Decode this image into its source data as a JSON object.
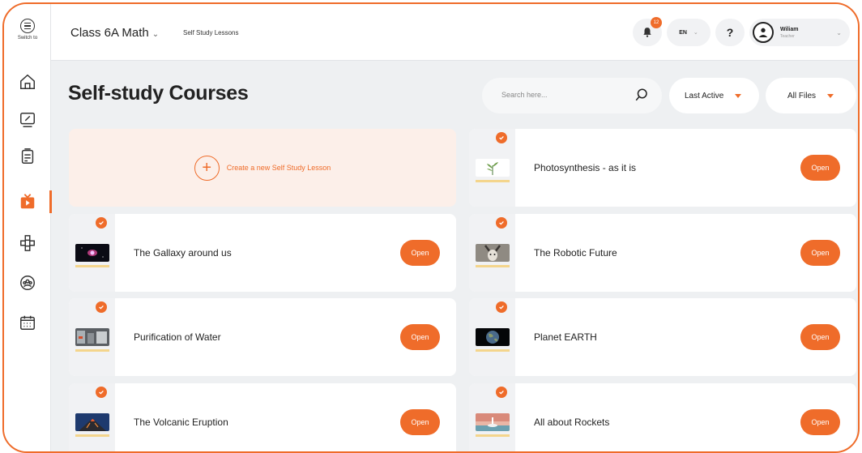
{
  "sidebar": {
    "switch_label": "Switch to",
    "items": [
      {
        "icon": "home-icon"
      },
      {
        "icon": "edit-board-icon"
      },
      {
        "icon": "document-icon"
      },
      {
        "icon": "tv-icon",
        "active": true
      },
      {
        "icon": "modules-icon"
      },
      {
        "icon": "group-icon"
      },
      {
        "icon": "calendar-icon"
      }
    ]
  },
  "topbar": {
    "class_name": "Class 6A Math",
    "breadcrumb": "Self Study Lessons",
    "notification_count": "12",
    "language": "EN",
    "help": "?",
    "user_name": "Wiliam",
    "user_role": "Teacher"
  },
  "main": {
    "title": "Self-study Courses",
    "search_placeholder": "Search here...",
    "sort_label": "Last Active",
    "filter_label": "All Files",
    "create_label": "Create a new Self Study Lesson",
    "open_label": "Open"
  },
  "courses": [
    {
      "title": "Photosynthesis - as it is",
      "thumb": "plant-thumbnail"
    },
    {
      "title": "The Gallaxy around us",
      "thumb": "galaxy-thumbnail"
    },
    {
      "title": "The Robotic Future",
      "thumb": "robot-thumbnail"
    },
    {
      "title": "Purification of Water",
      "thumb": "water-thumbnail"
    },
    {
      "title": "Planet EARTH",
      "thumb": "earth-thumbnail"
    },
    {
      "title": "The Volcanic Eruption",
      "thumb": "volcano-thumbnail"
    },
    {
      "title": "All about Rockets",
      "thumb": "rocket-thumbnail"
    }
  ],
  "colors": {
    "accent": "#ef6c2a",
    "background": "#eef0f2",
    "create_card_bg": "#fcefe9"
  }
}
